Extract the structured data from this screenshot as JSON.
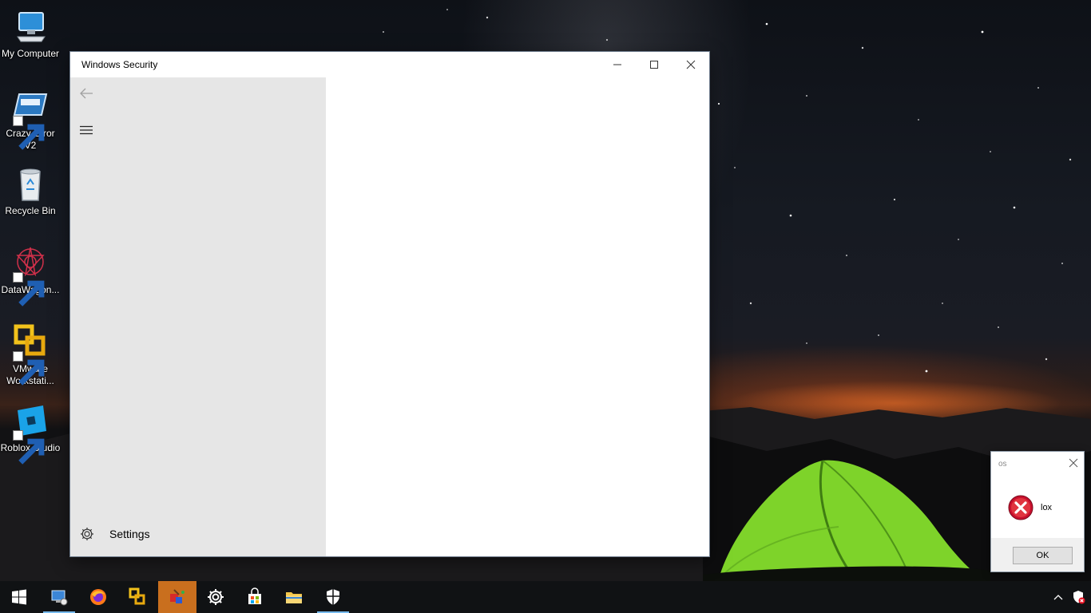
{
  "desktop": {
    "icons": [
      {
        "label": "My Computer",
        "icon": "computer-icon"
      },
      {
        "label": "Crazy Error V2",
        "icon": "error-app-icon"
      },
      {
        "label": "Recycle Bin",
        "icon": "recycle-bin-icon"
      },
      {
        "label": "DataWagon...",
        "icon": "datawagon-icon"
      },
      {
        "label": "VMware Workstati...",
        "icon": "vmware-icon"
      },
      {
        "label": "Roblox Studio",
        "icon": "roblox-studio-icon"
      }
    ]
  },
  "security_window": {
    "title": "Windows Security",
    "sidebar": {
      "settings_label": "Settings"
    },
    "colors": {
      "sidebar_bg": "#e6e6e6",
      "content_bg": "#ffffff"
    }
  },
  "message_box": {
    "title": "os",
    "message": "lox",
    "ok_label": "OK",
    "icon": "error-icon"
  },
  "taskbar": {
    "items": [
      {
        "name": "start",
        "icon": "windows-logo-icon"
      },
      {
        "name": "control-panel",
        "icon": "control-panel-icon",
        "running": true
      },
      {
        "name": "firefox",
        "icon": "firefox-icon"
      },
      {
        "name": "vmware",
        "icon": "vmware-icon"
      },
      {
        "name": "app",
        "icon": "app-icon",
        "active": true
      },
      {
        "name": "settings",
        "icon": "gear-icon"
      },
      {
        "name": "store",
        "icon": "store-icon"
      },
      {
        "name": "file-explorer",
        "icon": "folder-icon"
      },
      {
        "name": "windows-security",
        "icon": "shield-icon",
        "running": true
      }
    ],
    "tray": [
      {
        "name": "show-hidden",
        "icon": "chevron-up-icon"
      },
      {
        "name": "security-tray",
        "icon": "shield-warning-icon"
      }
    ],
    "accent": "#c96f1e"
  }
}
